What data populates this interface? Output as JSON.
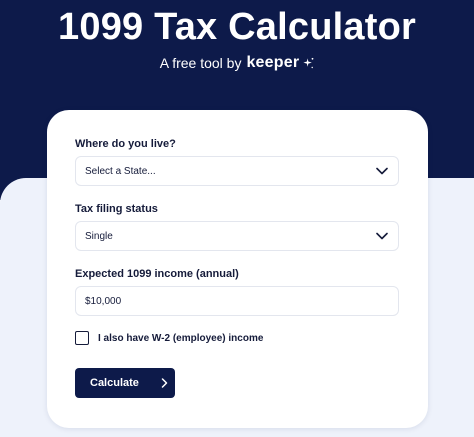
{
  "header": {
    "title": "1099 Tax Calculator",
    "subtitle": "A free tool by",
    "brand": "keeper"
  },
  "form": {
    "state": {
      "label": "Where do you live?",
      "value": "Select a State..."
    },
    "filing": {
      "label": "Tax filing status",
      "value": "Single"
    },
    "income": {
      "label": "Expected 1099 income (annual)",
      "value": "$10,000"
    },
    "w2_checkbox": {
      "label": "I also have W-2 (employee) income",
      "checked": false
    },
    "submit_label": "Calculate"
  },
  "icons": {
    "dropdown": "chevron-down-icon",
    "button": "chevron-right-icon",
    "brand": "sparkle-icon"
  },
  "colors": {
    "navy": "#0d1a4a",
    "background_light": "#eef2fb",
    "card": "#ffffff",
    "text": "#151b3a"
  }
}
